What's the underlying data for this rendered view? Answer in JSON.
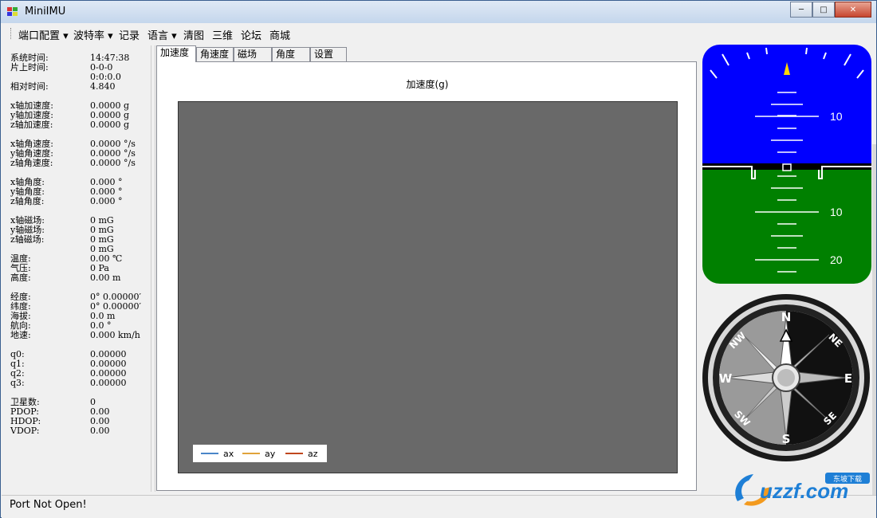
{
  "window": {
    "title": "MiniIMU",
    "buttons": {
      "minimize": "─",
      "maximize": "□",
      "close": "✕"
    }
  },
  "menu": [
    "端口配置 ▾",
    "波特率 ▾",
    "记录",
    "语言 ▾",
    "清图",
    "三维",
    "论坛",
    "商城"
  ],
  "left": {
    "rows": [
      {
        "label": "系统时间:",
        "value": "14:47:38"
      },
      {
        "label": "片上时间:",
        "value": "0-0-0"
      },
      {
        "label": "",
        "value": "0:0:0.0"
      },
      {
        "label": "相对时间:",
        "value": "4.840"
      },
      {
        "label": "x轴加速度:",
        "value": "0.0000 g"
      },
      {
        "label": "y轴加速度:",
        "value": "0.0000 g"
      },
      {
        "label": "z轴加速度:",
        "value": "0.0000 g"
      },
      {
        "label": "x轴角速度:",
        "value": "0.0000 °/s"
      },
      {
        "label": "y轴角速度:",
        "value": "0.0000 °/s"
      },
      {
        "label": "z轴角速度:",
        "value": "0.0000 °/s"
      },
      {
        "label": "x轴角度:",
        "value": "0.000 °"
      },
      {
        "label": "y轴角度:",
        "value": "0.000 °"
      },
      {
        "label": "z轴角度:",
        "value": "0.000 °"
      },
      {
        "label": "x轴磁场:",
        "value": "0 mG"
      },
      {
        "label": "y轴磁场:",
        "value": "0 mG"
      },
      {
        "label": "z轴磁场:",
        "value": "0 mG"
      },
      {
        "label": "",
        "value": "0 mG"
      },
      {
        "label": "温度:",
        "value": "0.00 ℃"
      },
      {
        "label": "气压:",
        "value": "0 Pa"
      },
      {
        "label": "高度:",
        "value": "0.00 m"
      },
      {
        "label": "经度:",
        "value": "0° 0.00000′"
      },
      {
        "label": "纬度:",
        "value": "0° 0.00000′"
      },
      {
        "label": "海拔:",
        "value": "0.0 m"
      },
      {
        "label": "航向:",
        "value": "0.0 °"
      },
      {
        "label": "地速:",
        "value": "0.000 km/h"
      },
      {
        "label": "q0:",
        "value": "0.00000"
      },
      {
        "label": "q1:",
        "value": "0.00000"
      },
      {
        "label": "q2:",
        "value": "0.00000"
      },
      {
        "label": "q3:",
        "value": "0.00000"
      },
      {
        "label": "卫星数:",
        "value": "0"
      },
      {
        "label": "PDOP:",
        "value": "0.00"
      },
      {
        "label": "HDOP:",
        "value": "0.00"
      },
      {
        "label": "VDOP:",
        "value": "0.00"
      }
    ]
  },
  "tabs": [
    "加速度",
    "角速度",
    "磁场",
    "角度",
    "设置"
  ],
  "chart": {
    "title": "加速度(g)",
    "legend": [
      {
        "name": "ax",
        "color": "#4a86c8"
      },
      {
        "name": "ay",
        "color": "#e0a33a"
      },
      {
        "name": "az",
        "color": "#c0471e"
      }
    ]
  },
  "attitude": {
    "pitch_labels": [
      "10",
      "10",
      "20"
    ],
    "sky_color": "#0000ff",
    "ground_color": "#008000"
  },
  "compass": {
    "labels": [
      "N",
      "NE",
      "E",
      "SE",
      "S",
      "SW",
      "W",
      "NW"
    ]
  },
  "status": {
    "text": "Port Not Open!"
  },
  "watermark": {
    "text": "uzzf.com",
    "badge": "东坡下载"
  }
}
